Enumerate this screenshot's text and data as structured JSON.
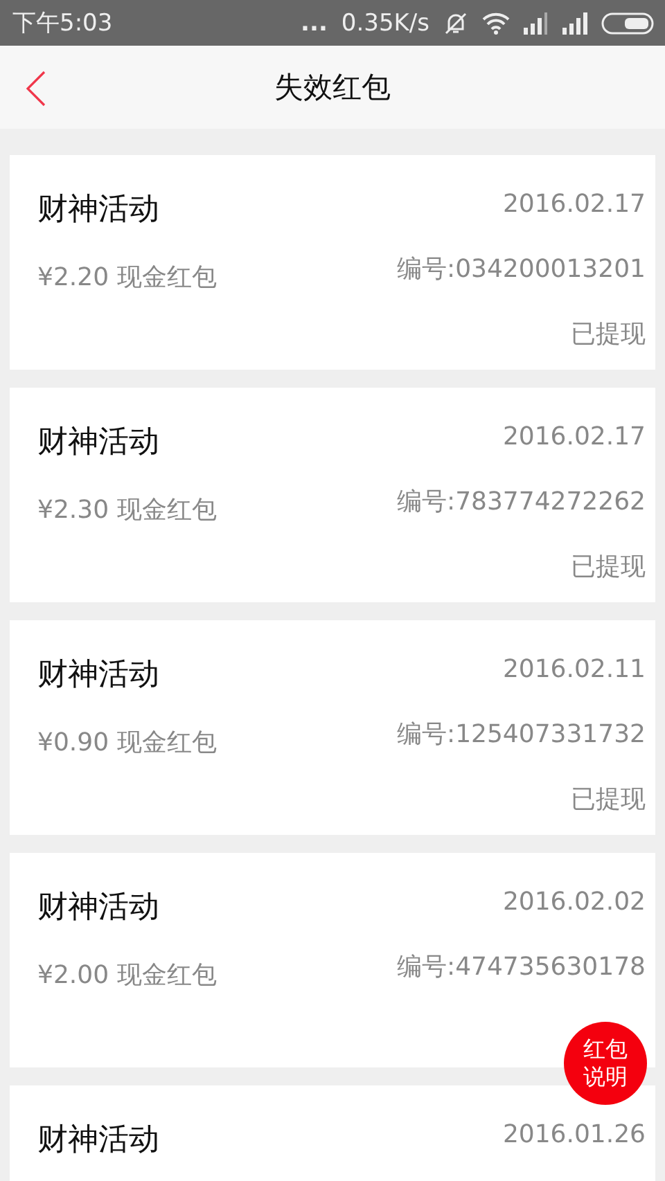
{
  "status_bar": {
    "time": "下午5:03",
    "more": "...",
    "speed": "0.35K/s"
  },
  "header": {
    "title": "失效红包"
  },
  "items": [
    {
      "title": "财神活动",
      "date": "2016.02.17",
      "amount": "¥2.20 现金红包",
      "code": "编号:034200013201",
      "status": "已提现"
    },
    {
      "title": "财神活动",
      "date": "2016.02.17",
      "amount": "¥2.30 现金红包",
      "code": "编号:783774272262",
      "status": "已提现"
    },
    {
      "title": "财神活动",
      "date": "2016.02.11",
      "amount": "¥0.90 现金红包",
      "code": "编号:125407331732",
      "status": "已提现"
    },
    {
      "title": "财神活动",
      "date": "2016.02.02",
      "amount": "¥2.00 现金红包",
      "code": "编号:474735630178"
    },
    {
      "title": "财神活动",
      "date": "2016.01.26"
    }
  ],
  "fab": {
    "line1": "红包",
    "line2": "说明"
  }
}
